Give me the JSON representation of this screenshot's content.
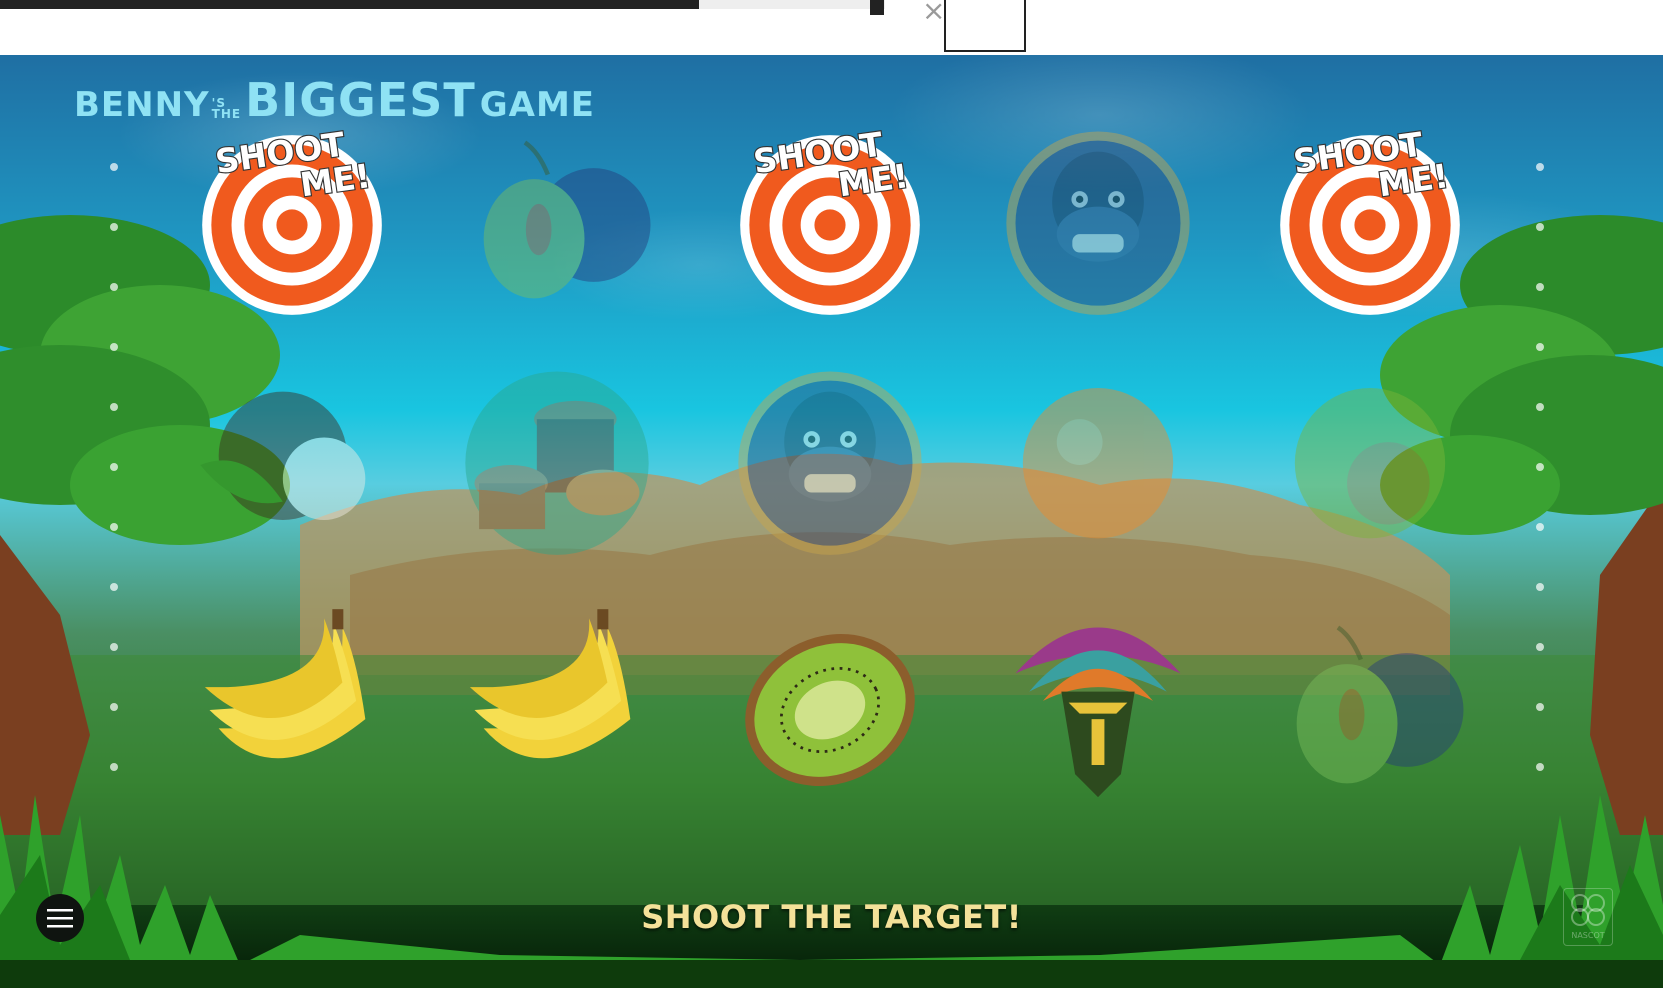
{
  "topbar": {
    "progress_percent": 79,
    "close_label": "×"
  },
  "logo": {
    "part1": "BENNY",
    "part2_top": "'S",
    "part2_bottom": "THE",
    "part3": "BIGGEST",
    "part4": "GAME"
  },
  "grid": {
    "rows": [
      [
        "target",
        "plum",
        "target",
        "gorilla",
        "target"
      ],
      [
        "coconut",
        "drums",
        "gorilla",
        "orange",
        "lime"
      ],
      [
        "banana",
        "banana",
        "kiwi",
        "mask",
        "plum"
      ]
    ],
    "target_text_1": "SHOOT",
    "target_text_2": "ME!"
  },
  "message": "SHOOT THE TARGET!",
  "brand_badge_text": "NASCOT",
  "colors": {
    "target_orange": "#f05a1e",
    "message_gold": "#f4e199",
    "logo_cyan": "#8fe2f4"
  }
}
